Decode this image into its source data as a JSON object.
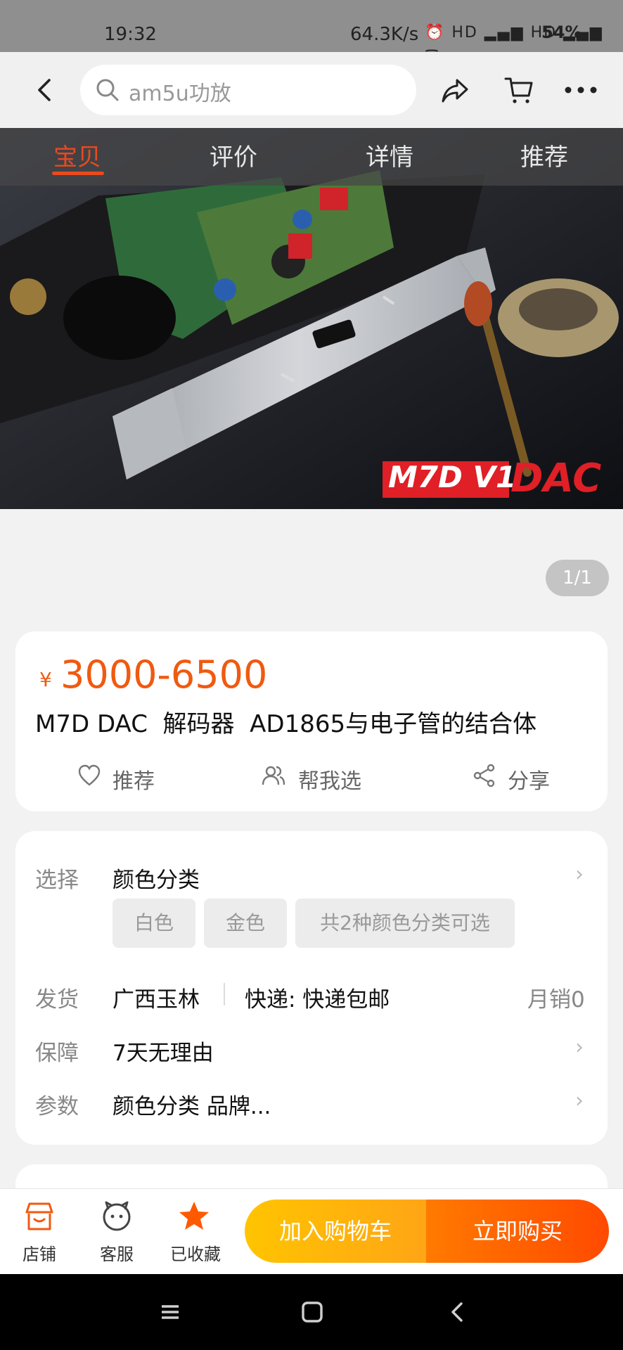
{
  "status_bar": {
    "time": "19:32",
    "speed": "64.3K/s",
    "icons": "⏰ HD ▂▄▆ HD ▂▄▆ ᯤ",
    "battery": "54%"
  },
  "header": {
    "search_placeholder": "am5u功放",
    "icons": [
      "back-icon",
      "search-icon",
      "share-icon",
      "cart-icon",
      "more-icon"
    ]
  },
  "hero": {
    "tabs": [
      "宝贝",
      "评价",
      "详情",
      "推荐"
    ],
    "active_tab": "宝贝",
    "logo_text_white": "M7D V1",
    "logo_text_red": "DAC",
    "page_indicator": "1/1"
  },
  "product": {
    "currency": "¥",
    "price": "3000-6500",
    "title": "M7D DAC  解码器  AD1865与电子管的结合体",
    "actions": [
      {
        "label": "推荐",
        "icon": "heart-icon"
      },
      {
        "label": "帮我选",
        "icon": "people-icon"
      },
      {
        "label": "分享",
        "icon": "share-icon"
      }
    ]
  },
  "info": {
    "select_label": "选择",
    "select_value": "颜色分类",
    "options": [
      "白色",
      "金色",
      "共2种颜色分类可选"
    ],
    "ship_label": "发货",
    "ship_from": "广西玉林",
    "ship_method": "快递: 快递包邮",
    "monthly_sales": "月销0",
    "guarantee_label": "保障",
    "guarantee_value": "7天无理由",
    "params_label": "参数",
    "params_value": "颜色分类 品牌...",
    "chevron": "›"
  },
  "bottom_bar": {
    "shop": "店铺",
    "service": "客服",
    "favorited": "已收藏",
    "add_cart": "加入购物车",
    "buy_now": "立即购买"
  },
  "colors": {
    "accent": "#f05a10",
    "cart_btn": "#ffb300",
    "buy_btn": "#ff5a00",
    "fav_star": "#ff5a00"
  }
}
